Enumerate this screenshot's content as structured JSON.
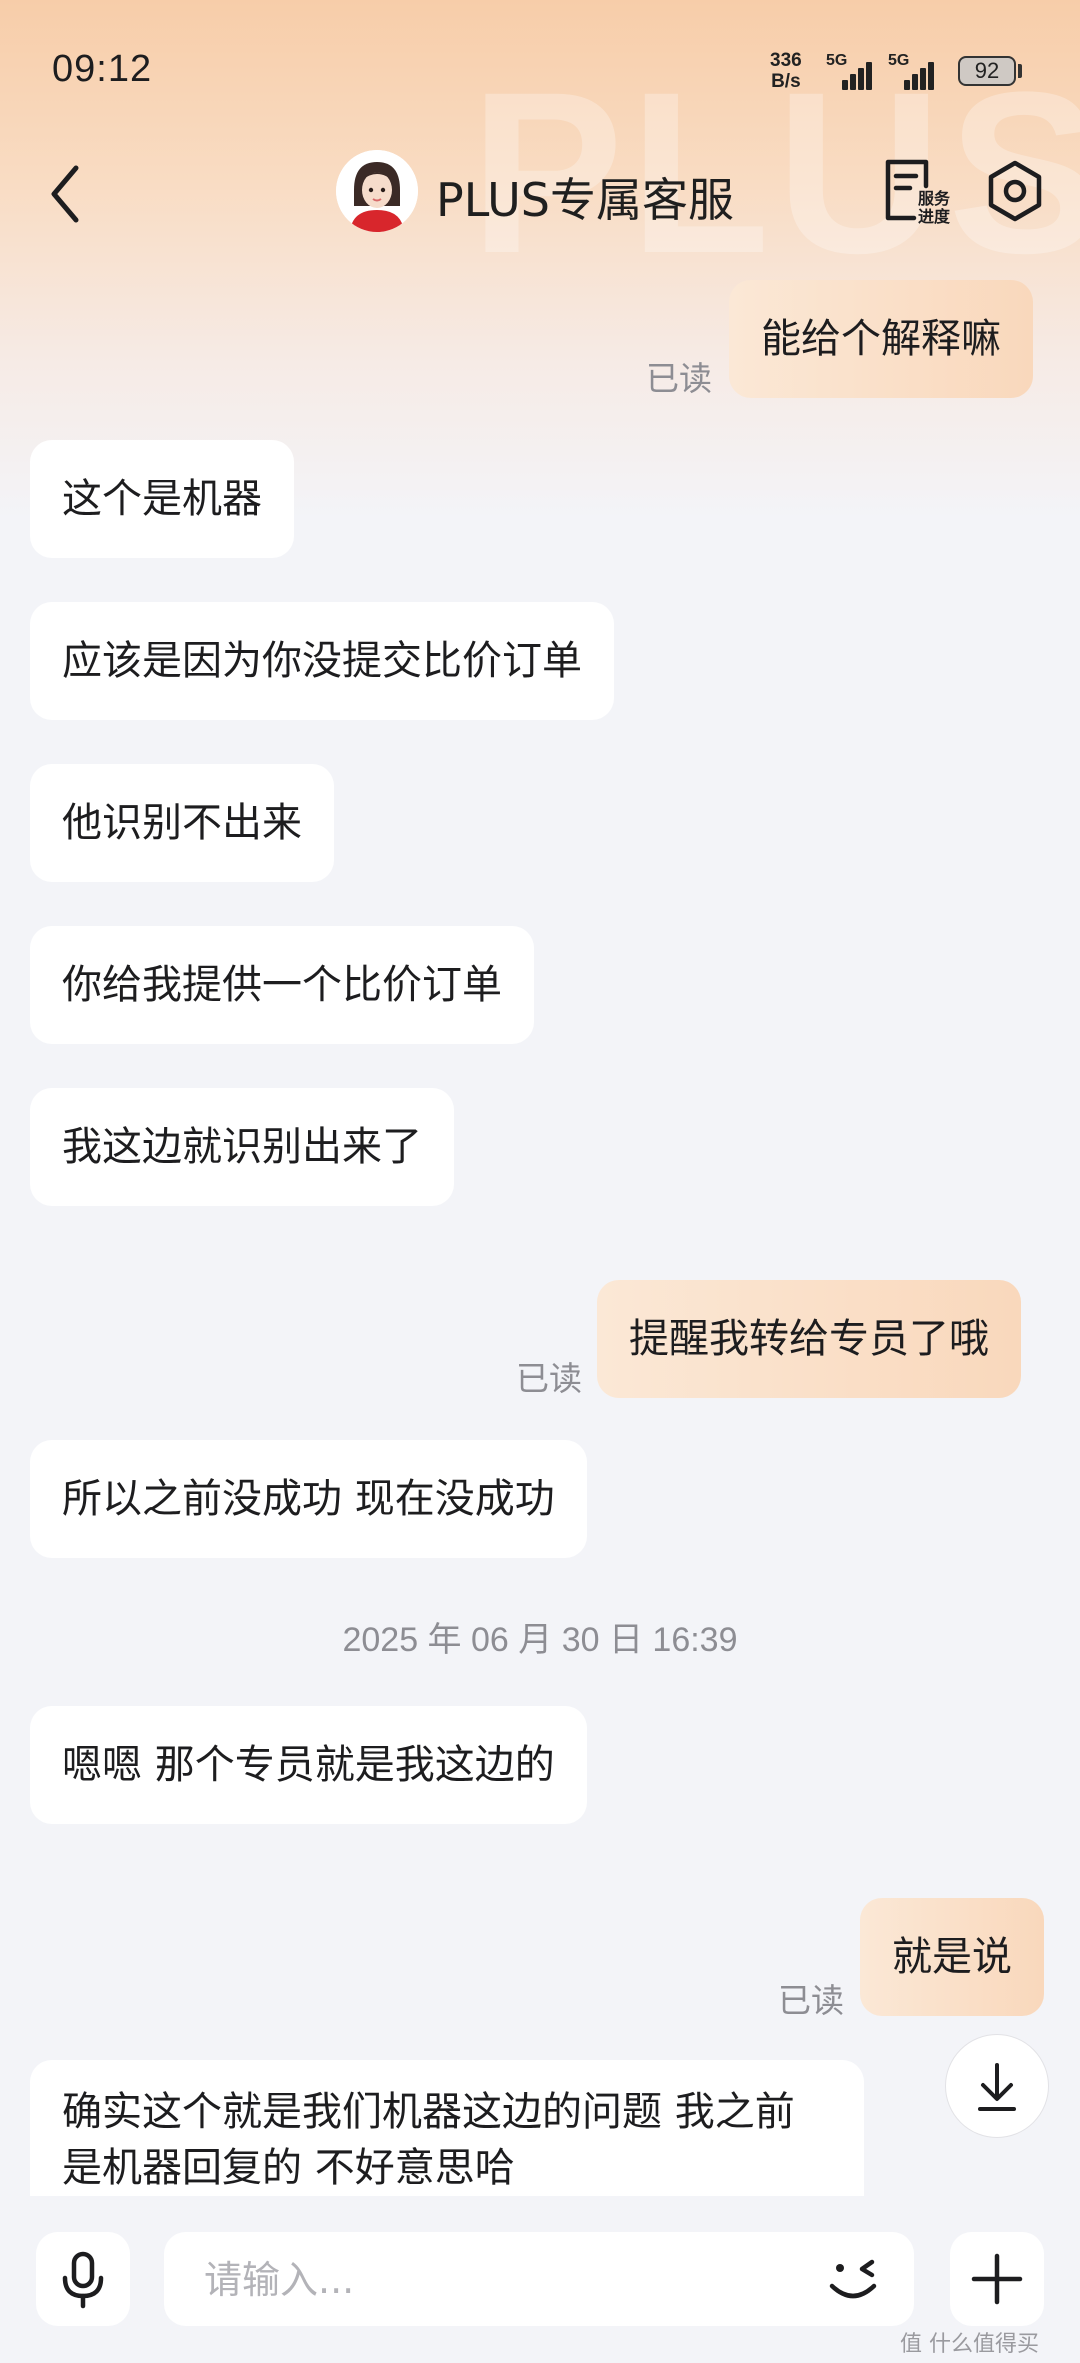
{
  "status_bar": {
    "time": "09:12",
    "net_speed_value": "336",
    "net_speed_unit": "B/s",
    "signal1_label": "5G",
    "signal2_label": "5G",
    "battery": "92"
  },
  "header": {
    "title": "PLUS专属客服",
    "service_label_1": "服务",
    "service_label_2": "进度",
    "watermark": "PLUS"
  },
  "messages": [
    {
      "side": "out",
      "text": "能给个解释嘛",
      "status": "已读"
    },
    {
      "side": "in",
      "text": "这个是机器"
    },
    {
      "side": "in",
      "text": "应该是因为你没提交比价订单"
    },
    {
      "side": "in",
      "text": "他识别不出来"
    },
    {
      "side": "in",
      "text": "你给我提供一个比价订单"
    },
    {
      "side": "in",
      "text": "我这边就识别出来了"
    },
    {
      "side": "out",
      "text": "提醒我转给专员了哦",
      "status": "已读"
    },
    {
      "side": "in",
      "text": "所以之前没成功 现在没成功"
    },
    {
      "side": "in",
      "text": "嗯嗯 那个专员就是我这边的"
    },
    {
      "side": "out",
      "text": "就是说",
      "status": "已读"
    },
    {
      "side": "in",
      "text": "确实这个就是我们机器这边的问题 我之前是机器回复的  不好意思哈"
    }
  ],
  "timestamp": "2025 年 06 月 30 日 16:39",
  "input": {
    "placeholder": "请输入..."
  },
  "corner_watermark": "值 什么值得买",
  "colors": {
    "accent_bubble": "#f9d8bc",
    "background": "#f3f4f8"
  }
}
